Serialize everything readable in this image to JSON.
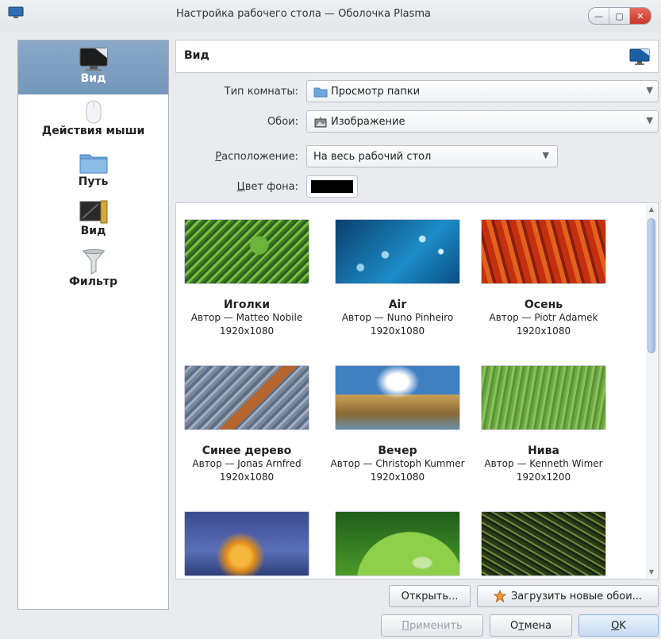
{
  "window": {
    "title": "Настройка рабочего стола — Оболочка Plasma",
    "controls": [
      "minimize",
      "maximize",
      "close"
    ]
  },
  "sidebar": {
    "items": [
      {
        "label": "Вид",
        "icon": "monitor-icon",
        "active": true
      },
      {
        "label": "Действия мыши",
        "icon": "mouse-icon",
        "active": false
      },
      {
        "label": "Путь",
        "icon": "folder-icon",
        "active": false
      },
      {
        "label": "Вид",
        "icon": "view-icon",
        "active": false
      },
      {
        "label": "Фильтр",
        "icon": "filter-icon",
        "active": false
      }
    ]
  },
  "header": {
    "title": "Вид",
    "icon": "monitor-icon"
  },
  "form": {
    "room_type": {
      "label": "Тип комнаты:",
      "value": "Просмотр папки",
      "icon": "folder-icon"
    },
    "wallpaper": {
      "label": "Обои:",
      "value": "Изображение",
      "icon": "image-icon"
    },
    "positioning": {
      "label_ul": "Р",
      "label_rest": "асположение:",
      "value": "На весь рабочий стол"
    },
    "bg_color": {
      "label_ul": "Ц",
      "label_rest": "вет фона:",
      "value": "#000000"
    }
  },
  "wallpapers": [
    {
      "name": "Иголки",
      "author": "Автор — Matteo Nobile",
      "resolution": "1920x1080"
    },
    {
      "name": "Air",
      "author": "Автор — Nuno Pinheiro",
      "resolution": "1920x1080"
    },
    {
      "name": "Осень",
      "author": "Автор — Piotr Adamek",
      "resolution": "1920x1080"
    },
    {
      "name": "Синее дерево",
      "author": "Автор — Jonas Arnfred",
      "resolution": "1920x1080"
    },
    {
      "name": "Вечер",
      "author": "Автор — Christoph Kummer",
      "resolution": "1920x1080"
    },
    {
      "name": "Нива",
      "author": "Автор — Kenneth Wimer",
      "resolution": "1920x1200"
    },
    {
      "name": "",
      "author": "",
      "resolution": ""
    },
    {
      "name": "",
      "author": "",
      "resolution": ""
    },
    {
      "name": "",
      "author": "",
      "resolution": ""
    }
  ],
  "buttons": {
    "open": "Открыть...",
    "download": "Загрузить новые обои...",
    "apply_ul": "П",
    "apply_rest": "рименить",
    "cancel_pre": "О",
    "cancel_ul": "т",
    "cancel_rest": "мена",
    "ok_ul": "O",
    "ok_rest": "K"
  }
}
